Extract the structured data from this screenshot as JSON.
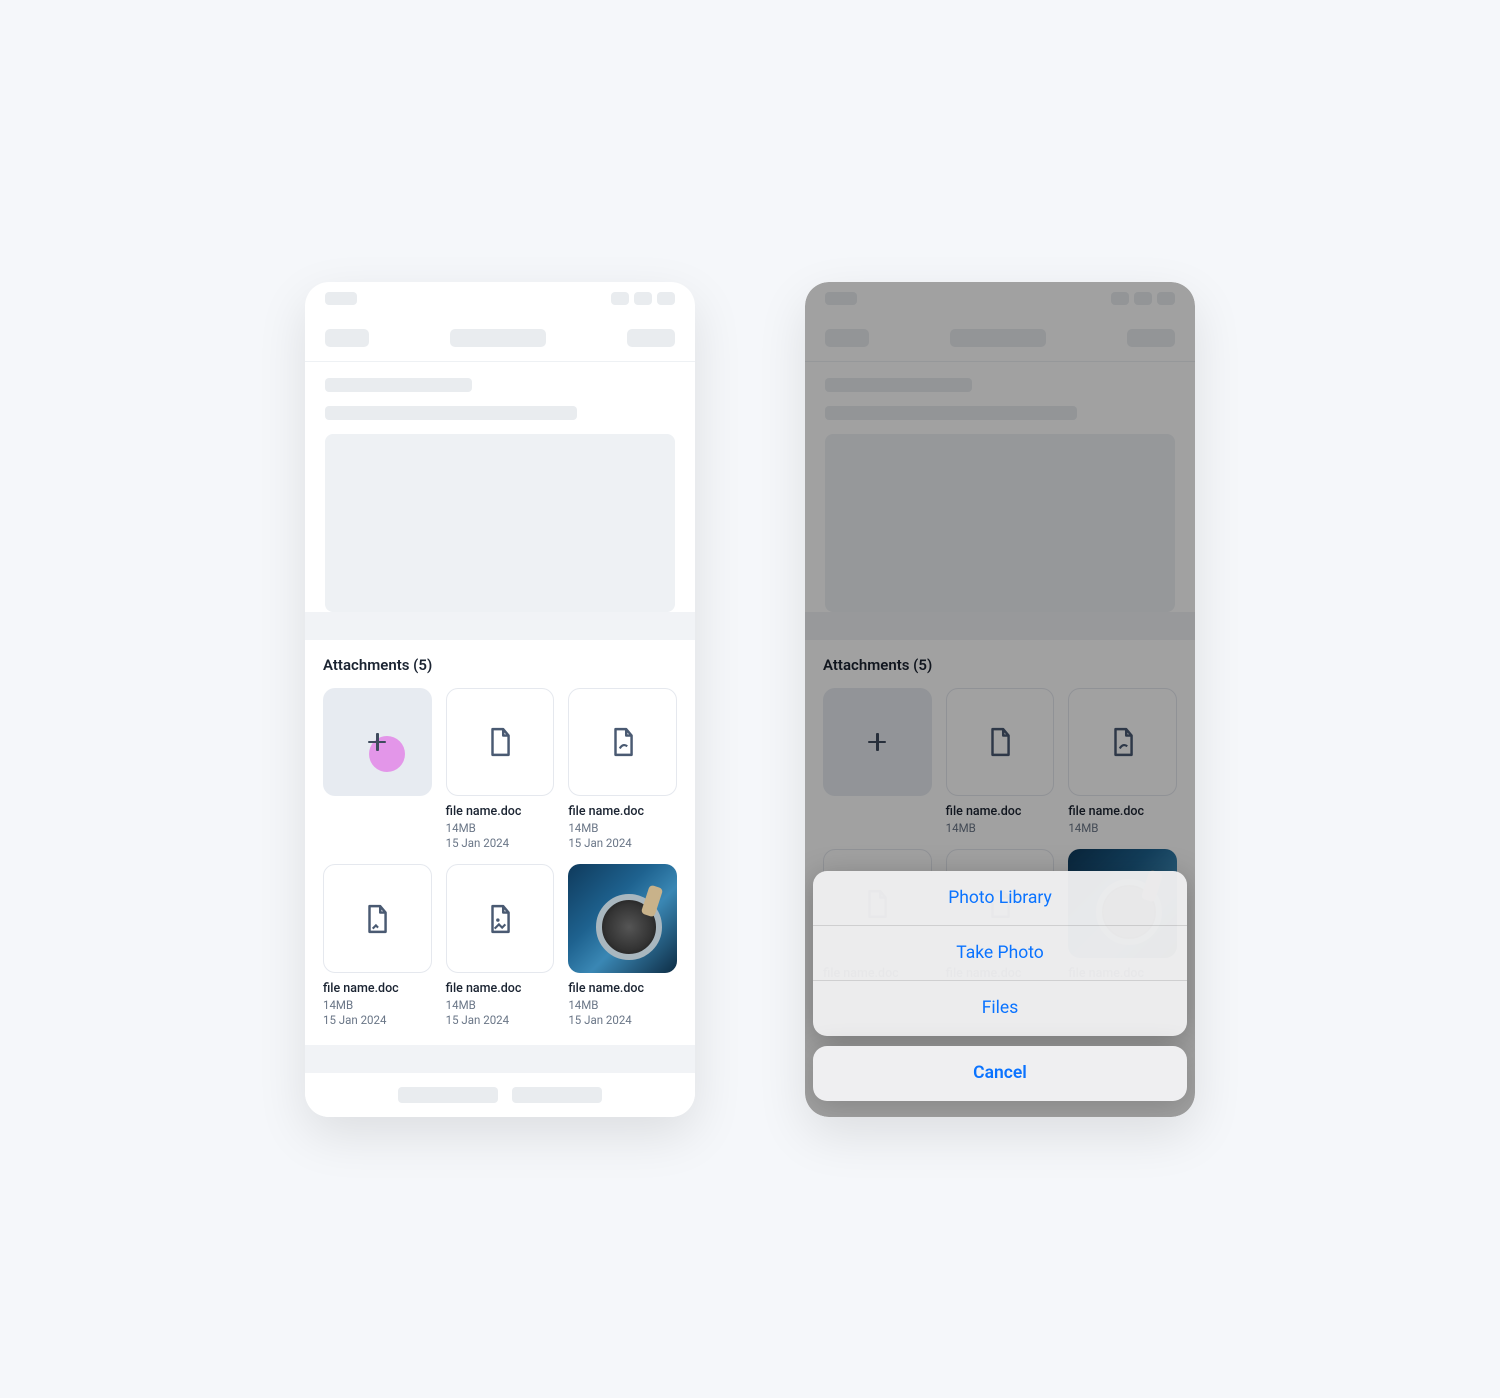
{
  "attachments": {
    "title": "Attachments (5)",
    "items": [
      {
        "name": "file name.doc",
        "size": "14MB",
        "date": "15 Jan 2024",
        "kind": "doc"
      },
      {
        "name": "file name.doc",
        "size": "14MB",
        "date": "15 Jan 2024",
        "kind": "pdf"
      },
      {
        "name": "file name.doc",
        "size": "14MB",
        "date": "15 Jan 2024",
        "kind": "annotated"
      },
      {
        "name": "file name.doc",
        "size": "14MB",
        "date": "15 Jan 2024",
        "kind": "image-file"
      },
      {
        "name": "file name.doc",
        "size": "14MB",
        "date": "15 Jan 2024",
        "kind": "photo"
      }
    ]
  },
  "action_sheet": {
    "options": [
      {
        "label": "Photo Library"
      },
      {
        "label": "Take Photo"
      },
      {
        "label": "Files"
      }
    ],
    "cancel": "Cancel"
  }
}
